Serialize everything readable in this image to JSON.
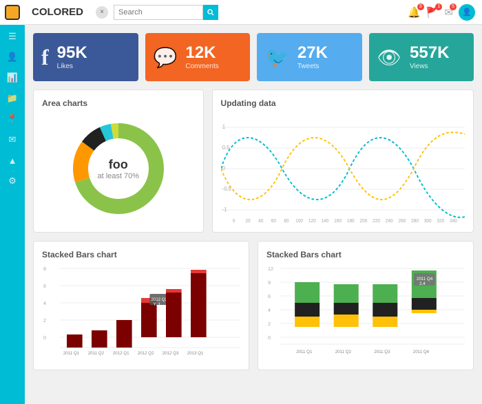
{
  "header": {
    "title": "COLORED",
    "close_label": "×",
    "search_placeholder": "Search",
    "search_icon": "🔍"
  },
  "sidebar": {
    "icons": [
      "☰",
      "👤",
      "📊",
      "📁",
      "📍",
      "✉",
      "▲",
      "⚙"
    ]
  },
  "stats": [
    {
      "id": "facebook",
      "icon": "f",
      "value": "95K",
      "label": "Likes",
      "color": "stat-facebook"
    },
    {
      "id": "comments",
      "icon": "💬",
      "value": "12K",
      "label": "Comments",
      "color": "stat-comments"
    },
    {
      "id": "twitter",
      "icon": "🐦",
      "value": "27K",
      "label": "Tweets",
      "color": "stat-twitter"
    },
    {
      "id": "views",
      "icon": "👁",
      "value": "557K",
      "label": "Views",
      "color": "stat-views"
    }
  ],
  "area_chart": {
    "title": "Area charts",
    "center_label": "foo",
    "center_sub": "at least 70%"
  },
  "line_chart": {
    "title": "Updating data"
  },
  "stacked_bar_left": {
    "title": "Stacked Bars chart",
    "y_max": "8",
    "labels": [
      "2011 Q1",
      "2011 Q2",
      "2012 Q1",
      "2012 Q2",
      "2012 Q3",
      "2013 Q1"
    ]
  },
  "stacked_bar_right": {
    "title": "Stacked Bars chart",
    "y_max": "12",
    "labels": [
      "2011 Q1",
      "2011 Q2",
      "2011 Q3",
      "2011 Q4"
    ]
  }
}
